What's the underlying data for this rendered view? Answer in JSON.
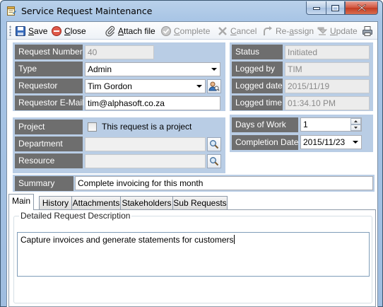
{
  "window": {
    "title": "Service Request Maintenance"
  },
  "toolbar": {
    "items": [
      {
        "label": "Save",
        "icon": "save-icon",
        "enabled": true
      },
      {
        "label": "Close",
        "icon": "close-circle-icon",
        "enabled": true
      },
      {
        "label": "Attach file",
        "icon": "paperclip-icon",
        "enabled": true
      },
      {
        "label": "Complete",
        "icon": "check-circle-icon",
        "enabled": false
      },
      {
        "label": "Cancel",
        "icon": "x-icon",
        "enabled": false
      },
      {
        "label": "Re-assign",
        "icon": "reassign-arrow-icon",
        "enabled": false
      },
      {
        "label": "Update",
        "icon": "update-icon",
        "enabled": false
      }
    ],
    "print_icon": "printer-icon"
  },
  "request": {
    "number_label": "Request Number",
    "number_value": "40",
    "type_label": "Type",
    "type_value": "Admin",
    "requestor_label": "Requestor",
    "requestor_value": "Tim Gordon",
    "email_label": "Requestor E-Mail",
    "email_value": "tim@alphasoft.co.za"
  },
  "status": {
    "status_label": "Status",
    "status_value": "Initiated",
    "logged_by_label": "Logged by",
    "logged_by_value": "TIM",
    "logged_date_label": "Logged date",
    "logged_date_value": "2015/11/19",
    "logged_time_label": "Logged time",
    "logged_time_value": "01:34.10 PM"
  },
  "project": {
    "project_label": "Project",
    "checkbox_label": "This request is a project",
    "checked": false,
    "department_label": "Department",
    "department_value": "",
    "resource_label": "Resource",
    "resource_value": ""
  },
  "schedule": {
    "days_label": "Days of Work",
    "days_value": "1",
    "completion_label": "Completion Date",
    "completion_value": "2015/11/23"
  },
  "summary": {
    "label": "Summary",
    "value": "Complete invoicing for this month"
  },
  "tabs": [
    {
      "label": "Main",
      "active": true
    },
    {
      "label": "History",
      "active": false
    },
    {
      "label": "Attachments",
      "active": false
    },
    {
      "label": "Stakeholders",
      "active": false
    },
    {
      "label": "Sub Requests",
      "active": false
    }
  ],
  "main_tab": {
    "group_title": "Detailed Request Description",
    "description": "Capture invoices and generate statements for customers"
  },
  "colors": {
    "panel": "#b9cde5",
    "label_bg": "#6e6e6e",
    "accent_close": "#c23b22"
  }
}
